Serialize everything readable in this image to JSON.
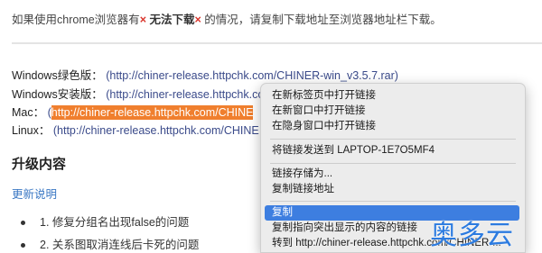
{
  "notice": {
    "prefix": "如果使用chrome浏览器有",
    "x1": "×",
    "bold": "无法下载",
    "x2": "×",
    "suffix": "的情况，请复制下载地址至浏览器地址栏下载。"
  },
  "downloads": [
    {
      "label": "Windows绿色版：",
      "url": "(http://chiner-release.httpchk.com/CHINER-win_v3.5.7.rar)"
    },
    {
      "label": "Windows安装版：",
      "url": "(http://chiner-release.httpchk.com/CHINER-"
    },
    {
      "label": "Mac：",
      "open": "(",
      "url": "http://chiner-release.httpchk.com/CHINE"
    },
    {
      "label": "Linux：",
      "url": "(http://chiner-release.httpchk.com/CHINE"
    }
  ],
  "section_title": "升级内容",
  "release_notes_link": "更新说明",
  "changes": [
    "1. 修复分组名出现false的问题",
    "2. 关系图取消连线后卡死的问题"
  ],
  "context_menu": {
    "items": [
      "在新标签页中打开链接",
      "在新窗口中打开链接",
      "在隐身窗口中打开链接",
      "将链接发送到 LAPTOP-1E7O5MF4",
      "链接存储为...",
      "复制链接地址",
      "复制",
      "复制指向突出显示的内容的链接",
      "转到 http://chiner-release.httpchk.com/CHINER-..."
    ],
    "highlighted_index": 6
  },
  "watermark": "奥多云"
}
